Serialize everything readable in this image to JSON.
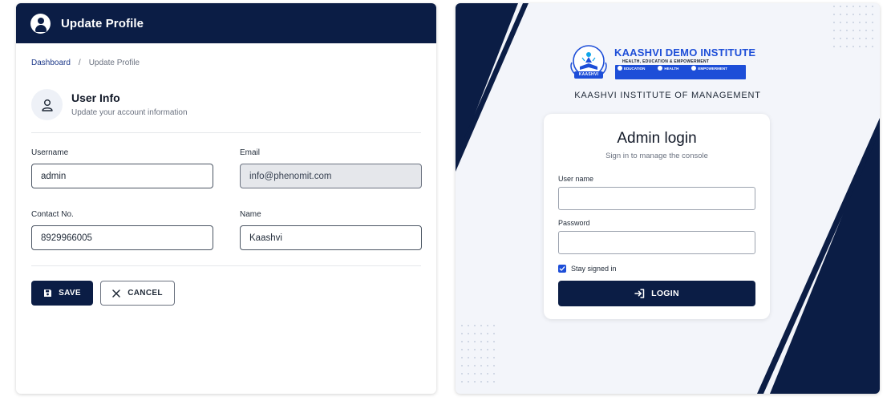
{
  "colors": {
    "navy": "#0b1d45",
    "brand_blue": "#1d4ed8",
    "panel_bg": "#f3f5fa"
  },
  "profile": {
    "header_title": "Update Profile",
    "header_icon": "user-circle-icon",
    "breadcrumb": {
      "home": "Dashboard",
      "separator": "/",
      "current": "Update Profile"
    },
    "section": {
      "title": "User Info",
      "subtitle": "Update your account information",
      "icon": "user-outline-icon"
    },
    "fields": {
      "username": {
        "label": "Username",
        "value": "admin"
      },
      "email": {
        "label": "Email",
        "value": "info@phenomit.com",
        "disabled": true
      },
      "contact": {
        "label": "Contact No.",
        "value": "8929966005"
      },
      "name": {
        "label": "Name",
        "value": "Kaashvi"
      }
    },
    "buttons": {
      "save": "SAVE",
      "save_icon": "floppy-disk-icon",
      "cancel": "CANCEL",
      "cancel_icon": "close-icon"
    }
  },
  "login": {
    "logo": {
      "title": "KAASHVI DEMO INSTITUTE",
      "tagline": "HEALTH, EDUCATION & EMPOWERMENT",
      "badge": "KAASHVI",
      "pillars": [
        "EDUCATION",
        "HEALTH",
        "EMPOWERMENT"
      ]
    },
    "institute_name": "KAASHVI INSTITUTE OF MANAGEMENT",
    "title": "Admin login",
    "subtitle": "Sign in to manage the console",
    "username_label": "User name",
    "username_value": "",
    "password_label": "Password",
    "password_value": "",
    "stay_signed_in": "Stay signed in",
    "stay_checked": true,
    "button": "LOGIN",
    "button_icon": "login-arrow-icon"
  }
}
